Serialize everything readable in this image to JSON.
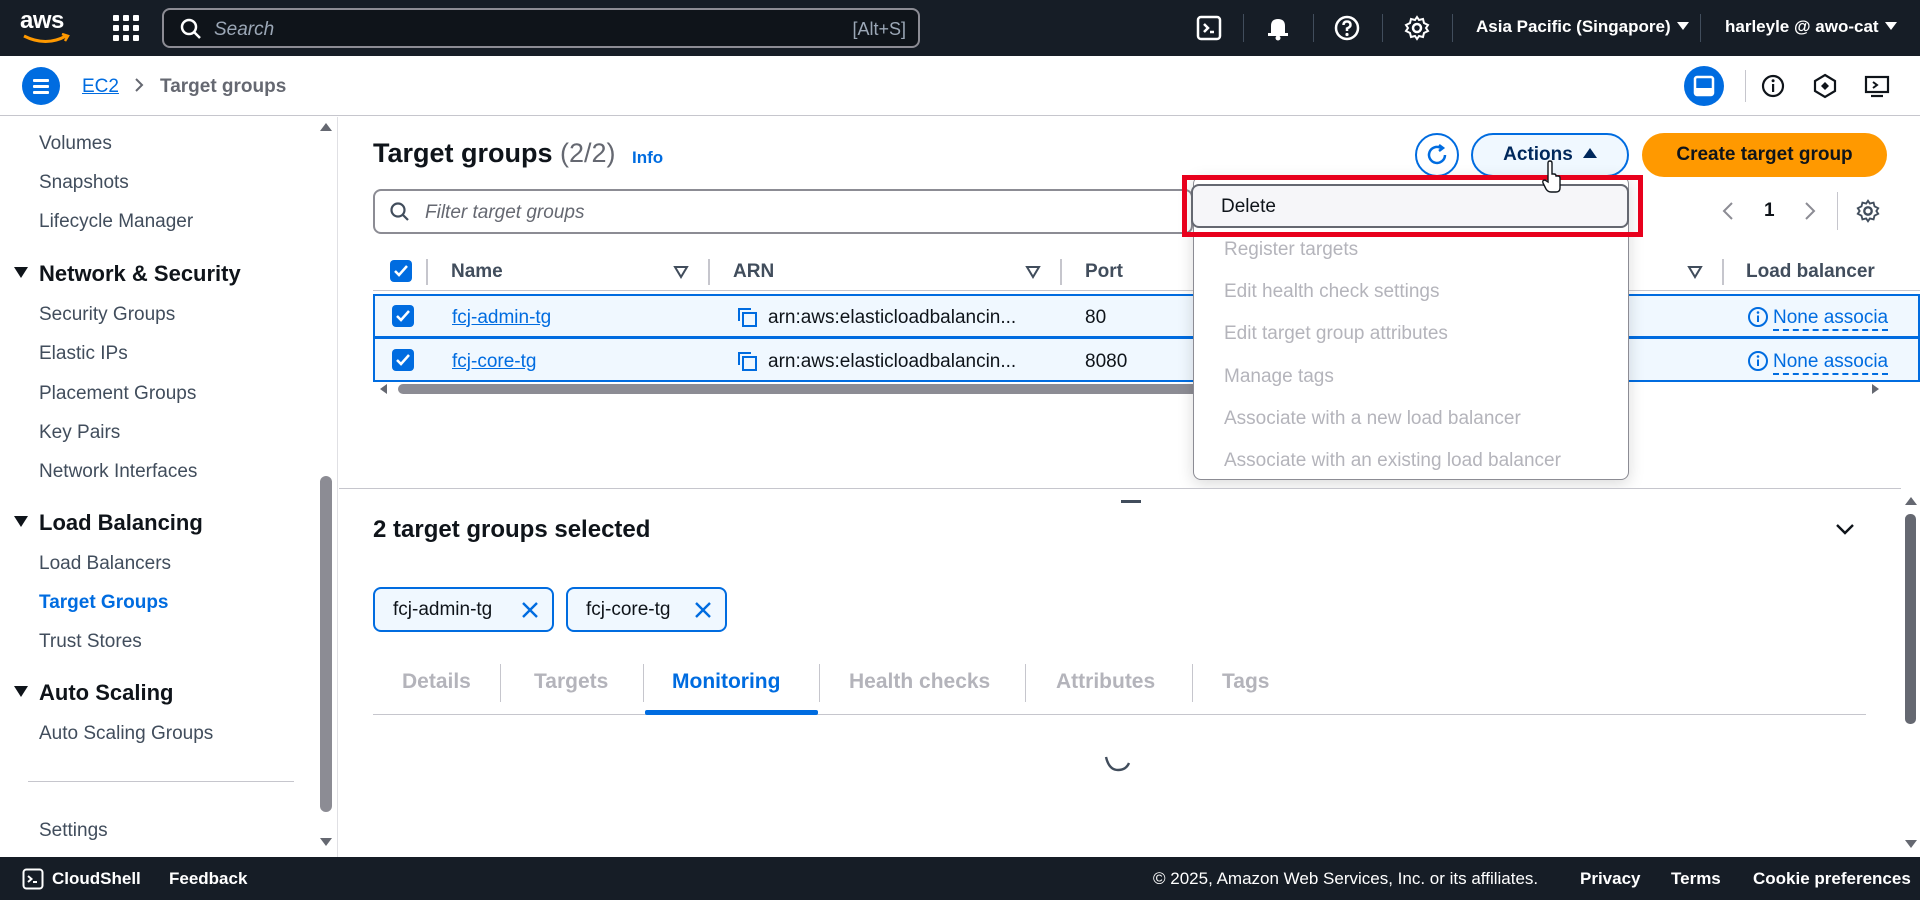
{
  "topnav": {
    "logo_text": "aws",
    "search_placeholder": "Search",
    "search_shortcut": "[Alt+S]",
    "region": "Asia Pacific (Singapore)",
    "account": "harleyle @ awo-cat"
  },
  "breadcrumb": {
    "root": "EC2",
    "current": "Target groups"
  },
  "sidebar": {
    "items_top": [
      "Volumes",
      "Snapshots",
      "Lifecycle Manager"
    ],
    "network_security": {
      "heading": "Network & Security",
      "items": [
        "Security Groups",
        "Elastic IPs",
        "Placement Groups",
        "Key Pairs",
        "Network Interfaces"
      ]
    },
    "load_balancing": {
      "heading": "Load Balancing",
      "items": [
        "Load Balancers",
        "Target Groups",
        "Trust Stores"
      ],
      "active": "Target Groups"
    },
    "auto_scaling": {
      "heading": "Auto Scaling",
      "items": [
        "Auto Scaling Groups"
      ]
    },
    "settings": "Settings"
  },
  "main": {
    "title": "Target groups",
    "count": "(2/2)",
    "info": "Info",
    "actions_label": "Actions",
    "create_label": "Create target group",
    "filter_placeholder": "Filter target groups",
    "page_number": "1",
    "columns": [
      "Name",
      "ARN",
      "Port",
      "Load balancer"
    ],
    "rows": [
      {
        "name": "fcj-admin-tg",
        "arn": "arn:aws:elasticloadbalancin...",
        "port": "80",
        "load_balancer": "None associa"
      },
      {
        "name": "fcj-core-tg",
        "arn": "arn:aws:elasticloadbalancin...",
        "port": "8080",
        "load_balancer": "None associa"
      }
    ]
  },
  "actions_menu": {
    "items": [
      {
        "label": "Delete",
        "enabled": true
      },
      {
        "label": "Register targets",
        "enabled": false
      },
      {
        "label": "Edit health check settings",
        "enabled": false
      },
      {
        "label": "Edit target group attributes",
        "enabled": false
      },
      {
        "label": "Manage tags",
        "enabled": false
      },
      {
        "label": "Associate with a new load balancer",
        "enabled": false
      },
      {
        "label": "Associate with an existing load balancer",
        "enabled": false
      }
    ]
  },
  "split_panel": {
    "title": "2 target groups selected",
    "tokens": [
      "fcj-admin-tg",
      "fcj-core-tg"
    ],
    "tabs": [
      "Details",
      "Targets",
      "Monitoring",
      "Health checks",
      "Attributes",
      "Tags"
    ],
    "active_tab": "Monitoring"
  },
  "footer": {
    "cloudshell": "CloudShell",
    "feedback": "Feedback",
    "copyright": "© 2025, Amazon Web Services, Inc. or its affiliates.",
    "privacy": "Privacy",
    "terms": "Terms",
    "cookies": "Cookie preferences"
  },
  "colors": {
    "nav_bg": "#161d26",
    "accent": "#006ce0",
    "primary_button": "#ff9900",
    "highlight_box": "#e8001c"
  }
}
